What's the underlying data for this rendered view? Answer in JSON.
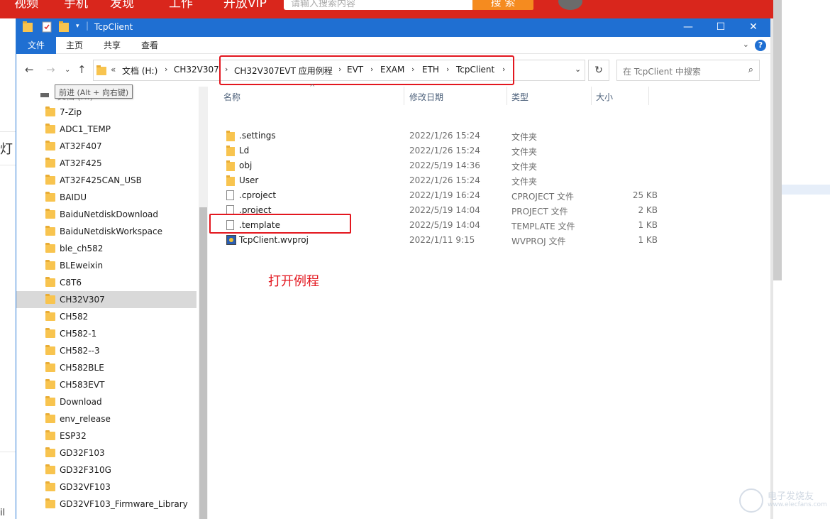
{
  "background": {
    "nav": [
      "视频",
      "手机",
      "发现",
      "工作",
      "开放VIP"
    ],
    "search_placeholder": "请输入搜索内容",
    "button": "搜 索",
    "left_char": "灯",
    "left_char2": "il"
  },
  "window": {
    "title": "TcpClient",
    "controls": {
      "minimize": "—",
      "maximize": "☐",
      "close": "✕"
    }
  },
  "ribbon": {
    "tabs": [
      "文件",
      "主页",
      "共享",
      "查看"
    ],
    "help": "?"
  },
  "address": {
    "crumbs": [
      "文档 (H:)",
      "CH32V307",
      "CH32V307EVT 应用例程",
      "EVT",
      "EXAM",
      "ETH",
      "TcpClient"
    ],
    "overflow": "«",
    "search_placeholder": "在 TcpClient 中搜索"
  },
  "tooltip": "前进 (Alt + 向右键)",
  "nav_pane": {
    "drive_label": "文档 (H:)",
    "items": [
      "7-Zip",
      "ADC1_TEMP",
      "AT32F407",
      "AT32F425",
      "AT32F425CAN_USB",
      "BAIDU",
      "BaiduNetdiskDownload",
      "BaiduNetdiskWorkspace",
      "ble_ch582",
      "BLEweixin",
      "C8T6",
      "CH32V307",
      "CH582",
      "CH582-1",
      "CH582--3",
      "CH582BLE",
      "CH583EVT",
      "Download",
      "env_release",
      "ESP32",
      "GD32F103",
      "GD32F310G",
      "GD32VF103",
      "GD32VF103_Firmware_Library"
    ],
    "selected": "CH32V307"
  },
  "columns": {
    "name": "名称",
    "date": "修改日期",
    "type": "类型",
    "size": "大小"
  },
  "files": [
    {
      "name": ".settings",
      "date": "2022/1/26 15:24",
      "type": "文件夹",
      "size": "",
      "icon": "folder-icon"
    },
    {
      "name": "Ld",
      "date": "2022/1/26 15:24",
      "type": "文件夹",
      "size": "",
      "icon": "folder-icon"
    },
    {
      "name": "obj",
      "date": "2022/5/19 14:36",
      "type": "文件夹",
      "size": "",
      "icon": "folder-icon"
    },
    {
      "name": "User",
      "date": "2022/1/26 15:24",
      "type": "文件夹",
      "size": "",
      "icon": "folder-icon"
    },
    {
      "name": ".cproject",
      "date": "2022/1/19 16:24",
      "type": "CPROJECT 文件",
      "size": "25 KB",
      "icon": "file-icon"
    },
    {
      "name": ".project",
      "date": "2022/5/19 14:04",
      "type": "PROJECT 文件",
      "size": "2 KB",
      "icon": "file-icon"
    },
    {
      "name": ".template",
      "date": "2022/5/19 14:04",
      "type": "TEMPLATE 文件",
      "size": "1 KB",
      "icon": "file-icon"
    },
    {
      "name": "TcpClient.wvproj",
      "date": "2022/1/11 9:15",
      "type": "WVPROJ 文件",
      "size": "1 KB",
      "icon": "wvproj-icon"
    }
  ],
  "annotation": "打开例程",
  "watermark": {
    "line1": "电子发烧友",
    "line2": "www.elecfans.com"
  },
  "colors": {
    "titlebar": "#1f6fd2",
    "highlight": "#e3171f",
    "folder": "#f8c44f"
  }
}
